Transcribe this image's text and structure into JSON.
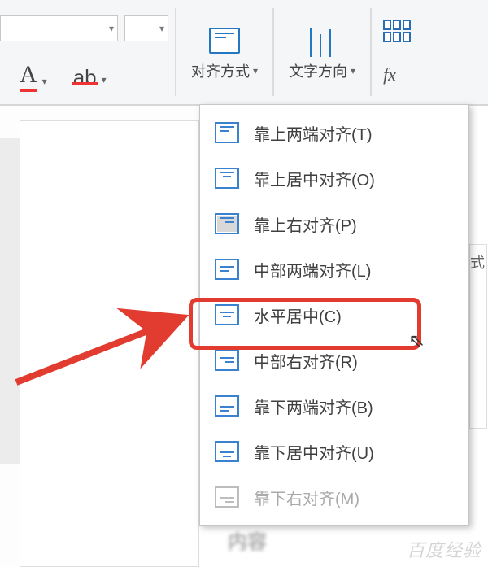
{
  "ribbon": {
    "alignment": {
      "label": "对齐方式"
    },
    "text_direction": {
      "label": "文字方向"
    },
    "fx": "fx"
  },
  "dropdown": {
    "items": [
      {
        "label": "靠上两端对齐(T)",
        "icon": "top-left",
        "selected": false,
        "disabled": false
      },
      {
        "label": "靠上居中对齐(O)",
        "icon": "top-center",
        "selected": false,
        "disabled": false
      },
      {
        "label": "靠上右对齐(P)",
        "icon": "top-right",
        "selected": true,
        "disabled": false
      },
      {
        "label": "中部两端对齐(L)",
        "icon": "mid-left",
        "selected": false,
        "disabled": false
      },
      {
        "label": "水平居中(C)",
        "icon": "mid-center",
        "selected": false,
        "disabled": false
      },
      {
        "label": "中部右对齐(R)",
        "icon": "mid-right",
        "selected": false,
        "disabled": false
      },
      {
        "label": "靠下两端对齐(B)",
        "icon": "bot-left",
        "selected": false,
        "disabled": false
      },
      {
        "label": "靠下居中对齐(U)",
        "icon": "bot-center",
        "selected": false,
        "disabled": false
      },
      {
        "label": "靠下右对齐(M)",
        "icon": "bot-right",
        "selected": false,
        "disabled": true
      }
    ],
    "highlighted_index": 4
  },
  "right_fragment": "式"
}
